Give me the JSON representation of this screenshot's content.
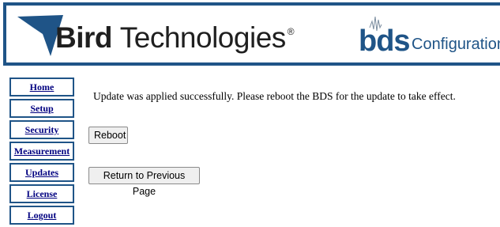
{
  "banner": {
    "company_name_bold": "Bird",
    "company_name_rest": "Technologies",
    "registered_mark": "®",
    "product_logo": "bds",
    "product_subtitle": "Configuration",
    "colors": {
      "border": "#1f5487",
      "brand_blue": "#1f5487"
    }
  },
  "nav": {
    "items": [
      {
        "label": "Home"
      },
      {
        "label": "Setup"
      },
      {
        "label": "Security"
      },
      {
        "label": "Measurement"
      },
      {
        "label": "Updates"
      },
      {
        "label": "License"
      },
      {
        "label": "Logout"
      }
    ]
  },
  "main": {
    "message": "Update was applied successfully. Please reboot the BDS for the update to take effect.",
    "reboot_button": "Reboot",
    "return_button": "Return to Previous Page"
  }
}
